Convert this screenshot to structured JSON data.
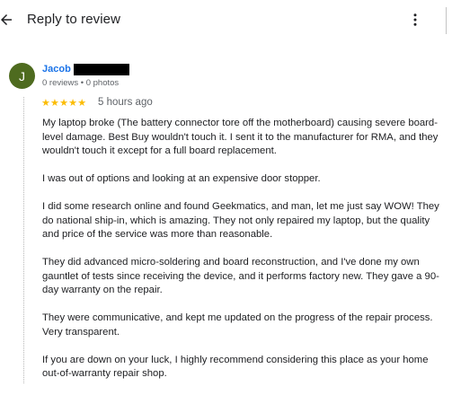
{
  "header": {
    "title": "Reply to review",
    "back_icon": "arrow-left-icon",
    "more_icon": "more-vert-icon"
  },
  "review": {
    "avatar_letter": "J",
    "avatar_color": "#4e6b1f",
    "author_name": "Jacob",
    "author_meta": "0 reviews • 0 photos",
    "stars": "★★★★★",
    "rating": 5,
    "star_color": "#fbbc04",
    "time": "5 hours ago",
    "paragraphs": [
      "My laptop broke (The battery connector tore off the motherboard) causing severe board-level damage. Best Buy wouldn't touch it. I sent it to the manufacturer for RMA, and they wouldn't touch it except for a full board replacement.",
      "I was out of options and looking at an expensive door stopper.",
      "I did some research online and found Geekmatics, and man, let me just say WOW! They do national ship-in, which is amazing. They not only repaired my laptop, but the quality and price of the service was more than reasonable.",
      "They did advanced micro-soldering and board reconstruction, and I've done my own gauntlet of tests since receiving the device, and it performs factory new. They gave a 90-day warranty on the repair.",
      "They were communicative, and kept me updated on the progress of the repair process. Very transparent.",
      "If you are down on your luck, I highly recommend considering this place as your home out-of-warranty repair shop."
    ]
  }
}
